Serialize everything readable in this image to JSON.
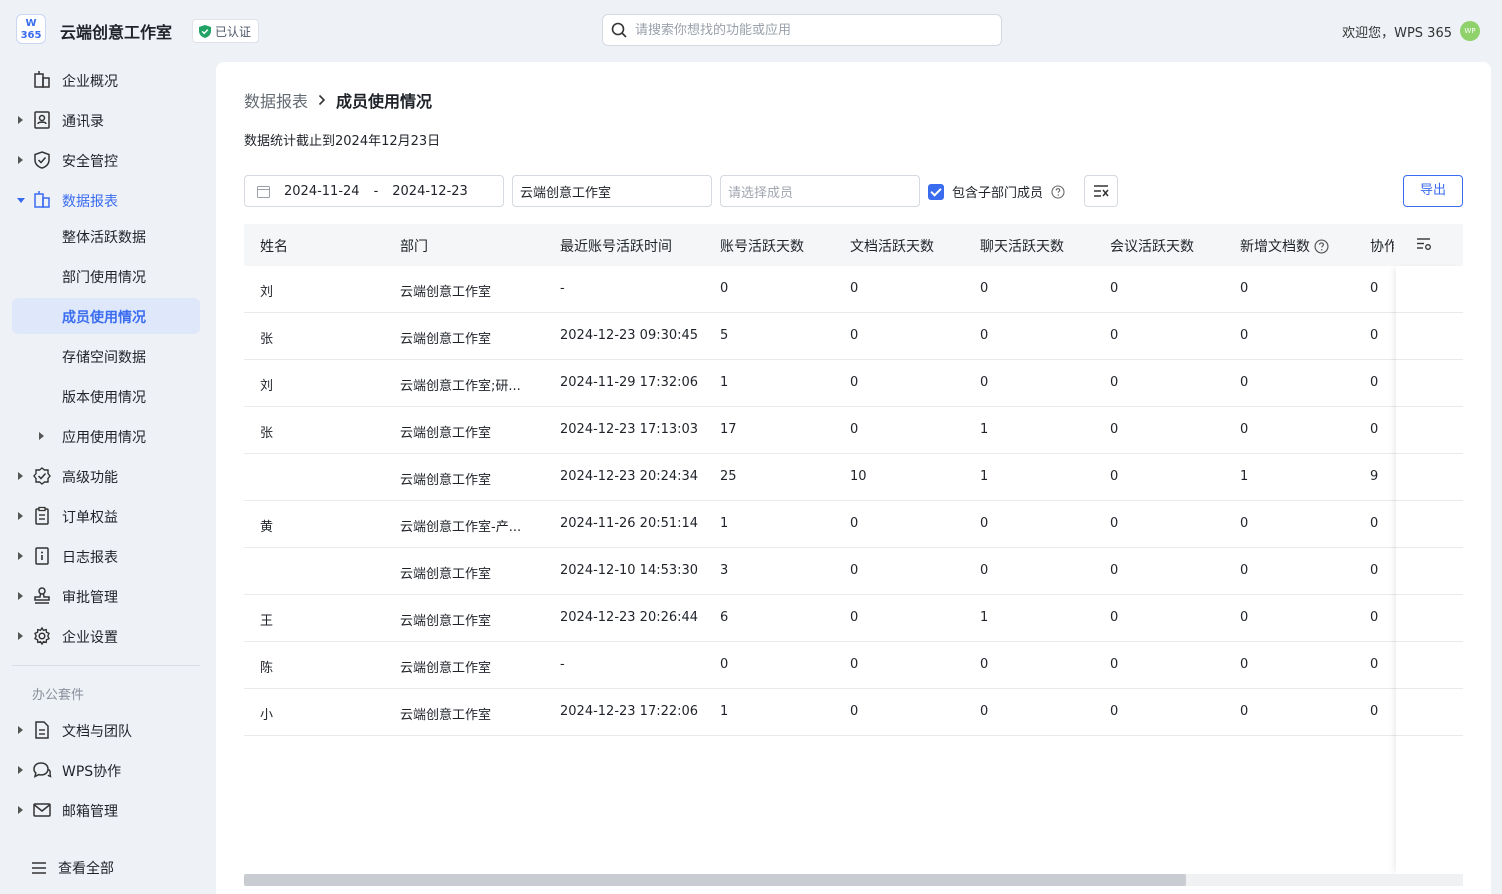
{
  "header": {
    "logo_text": "W\n365",
    "org_name": "云端创意工作室",
    "cert_label": "已认证",
    "search_placeholder": "请搜索你想找的功能或应用",
    "welcome": "欢迎您，WPS 365",
    "avatar_text": "WP"
  },
  "sidebar": {
    "items": [
      {
        "label": "企业概况",
        "icon": "building-icon",
        "caret": false
      },
      {
        "label": "通讯录",
        "icon": "contacts-icon",
        "caret": true
      },
      {
        "label": "安全管控",
        "icon": "shield-check-icon",
        "caret": true
      },
      {
        "label": "数据报表",
        "icon": "report-icon",
        "caret": true,
        "expanded": true
      },
      {
        "label": "高级功能",
        "icon": "badge-check-icon",
        "caret": true
      },
      {
        "label": "订单权益",
        "icon": "clipboard-icon",
        "caret": true
      },
      {
        "label": "日志报表",
        "icon": "log-icon",
        "caret": true
      },
      {
        "label": "审批管理",
        "icon": "stamp-icon",
        "caret": true
      },
      {
        "label": "企业设置",
        "icon": "gear-icon",
        "caret": true
      }
    ],
    "sub_items": [
      {
        "label": "整体活跃数据"
      },
      {
        "label": "部门使用情况"
      },
      {
        "label": "成员使用情况",
        "selected": true
      },
      {
        "label": "存储空间数据"
      },
      {
        "label": "版本使用情况"
      },
      {
        "label": "应用使用情况",
        "caret": true
      }
    ],
    "group_label": "办公套件",
    "office_items": [
      {
        "label": "文档与团队",
        "icon": "document-icon"
      },
      {
        "label": "WPS协作",
        "icon": "chat-icon"
      },
      {
        "label": "邮箱管理",
        "icon": "mail-icon"
      }
    ],
    "view_all": "查看全部"
  },
  "main": {
    "breadcrumb_parent": "数据报表",
    "breadcrumb_current": "成员使用情况",
    "stat_note": "数据统计截止到2024年12月23日",
    "date_start": "2024-11-24",
    "date_sep": "-",
    "date_end": "2024-12-23",
    "dept_value": "云端创意工作室",
    "member_placeholder": "请选择成员",
    "include_sub_label": "包含子部门成员",
    "export_label": "导出"
  },
  "table": {
    "columns": [
      "姓名",
      "部门",
      "最近账号活跃时间",
      "账号活跃天数",
      "文档活跃天数",
      "聊天活跃天数",
      "会议活跃天数",
      "新增文档数",
      "协作"
    ],
    "rows": [
      [
        "刘",
        "云端创意工作室",
        "-",
        "0",
        "0",
        "0",
        "0",
        "0",
        "0"
      ],
      [
        "张",
        "云端创意工作室",
        "2024-12-23 09:30:45",
        "5",
        "0",
        "0",
        "0",
        "0",
        "0"
      ],
      [
        "刘",
        "云端创意工作室;研...",
        "2024-11-29 17:32:06",
        "1",
        "0",
        "0",
        "0",
        "0",
        "0"
      ],
      [
        "张",
        "云端创意工作室",
        "2024-12-23 17:13:03",
        "17",
        "0",
        "1",
        "0",
        "0",
        "0"
      ],
      [
        "",
        "云端创意工作室",
        "2024-12-23 20:24:34",
        "25",
        "10",
        "1",
        "0",
        "1",
        "9"
      ],
      [
        "黄",
        "云端创意工作室-产...",
        "2024-11-26 20:51:14",
        "1",
        "0",
        "0",
        "0",
        "0",
        "0"
      ],
      [
        "",
        "云端创意工作室",
        "2024-12-10 14:53:30",
        "3",
        "0",
        "0",
        "0",
        "0",
        "0"
      ],
      [
        "王",
        "云端创意工作室",
        "2024-12-23 20:26:44",
        "6",
        "0",
        "1",
        "0",
        "0",
        "0"
      ],
      [
        "陈",
        "云端创意工作室",
        "-",
        "0",
        "0",
        "0",
        "0",
        "0",
        "0"
      ],
      [
        "小",
        "云端创意工作室",
        "2024-12-23 17:22:06",
        "1",
        "0",
        "0",
        "0",
        "0",
        "0"
      ]
    ]
  },
  "colors": {
    "accent": "#3a6cf0",
    "selected_bg": "#dfe8fb",
    "page_bg": "#eef1f6"
  }
}
